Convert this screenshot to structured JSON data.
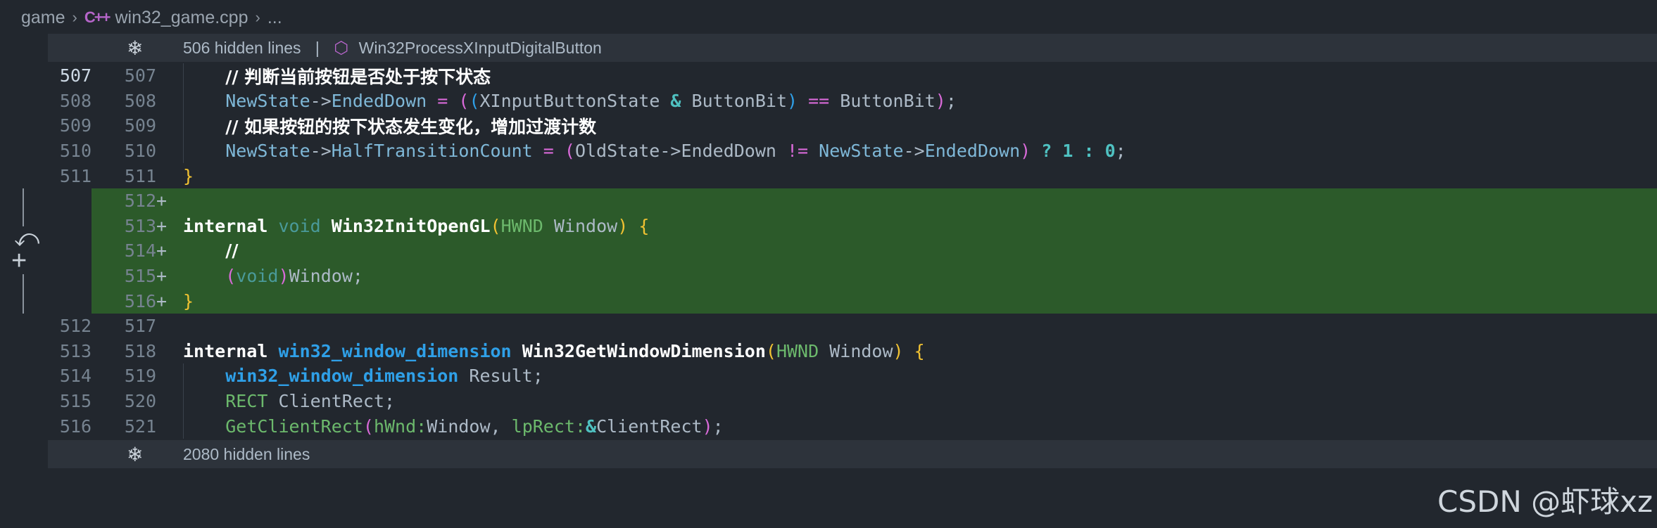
{
  "breadcrumb": {
    "root": "game",
    "file_icon": "cpp-icon",
    "file": "win32_game.cpp",
    "more": "..."
  },
  "fold_top": {
    "hidden": "506 hidden lines",
    "divider": "|",
    "symbol": "Win32ProcessXInputDigitalButton"
  },
  "fold_bottom": {
    "hidden": "2080 hidden lines"
  },
  "lines": [
    {
      "old": "507",
      "new": "507",
      "mark": ""
    },
    {
      "old": "508",
      "new": "508",
      "mark": ""
    },
    {
      "old": "509",
      "new": "509",
      "mark": ""
    },
    {
      "old": "510",
      "new": "510",
      "mark": ""
    },
    {
      "old": "511",
      "new": "511",
      "mark": ""
    },
    {
      "old": "",
      "new": "512",
      "mark": "+"
    },
    {
      "old": "",
      "new": "513",
      "mark": "+"
    },
    {
      "old": "",
      "new": "514",
      "mark": "+"
    },
    {
      "old": "",
      "new": "515",
      "mark": "+"
    },
    {
      "old": "",
      "new": "516",
      "mark": "+"
    },
    {
      "old": "512",
      "new": "517",
      "mark": ""
    },
    {
      "old": "513",
      "new": "518",
      "mark": ""
    },
    {
      "old": "514",
      "new": "519",
      "mark": ""
    },
    {
      "old": "515",
      "new": "520",
      "mark": ""
    },
    {
      "old": "516",
      "new": "521",
      "mark": ""
    }
  ],
  "code": {
    "l507": {
      "comment": "// 判断当前按钮是否处于按下状态"
    },
    "l508": {
      "a": "NewState",
      "arrow": "->",
      "b": "EndedDown",
      "eq": " = ",
      "p1": "(",
      "p2": "(",
      "c": "XInputButtonState",
      "amp": " & ",
      "d": "ButtonBit",
      "p3": ")",
      "eqeq": " == ",
      "e": "ButtonBit",
      "p4": ")",
      "semi": ";"
    },
    "l509": {
      "comment": "// 如果按钮的按下状态发生变化，增加过渡计数"
    },
    "l510": {
      "a": "NewState",
      "arrow": "->",
      "b": "HalfTransitionCount",
      "eq": " = ",
      "p1": "(",
      "c": "OldState",
      "arrow2": "->",
      "d": "EndedDown",
      "neq": " != ",
      "e": "NewState",
      "arrow3": "->",
      "f": "EndedDown",
      "p2": ")",
      "q": " ? ",
      "one": "1",
      "colon": " : ",
      "zero": "0",
      "semi": ";"
    },
    "l511": {
      "brace": "}"
    },
    "l512": {
      "text": ""
    },
    "l513": {
      "kw": "internal",
      "void": "void",
      "fn": "Win32InitOpenGL",
      "p1": "(",
      "type": "HWND",
      "arg": "Window",
      "p2": ")",
      "brace": "{"
    },
    "l514": {
      "text": "//"
    },
    "l515": {
      "p1": "(",
      "void": "void",
      "p2": ")",
      "rest": "Window;"
    },
    "l516": {
      "brace": "}"
    },
    "l517": {
      "text": ""
    },
    "l518": {
      "kw": "internal",
      "type": "win32_window_dimension",
      "fn": "Win32GetWindowDimension",
      "p1": "(",
      "atype": "HWND",
      "arg": "Window",
      "p2": ")",
      "brace": "{"
    },
    "l519": {
      "type": "win32_window_dimension",
      "rest": "Result;"
    },
    "l520": {
      "type": "RECT",
      "rest": "ClientRect;"
    },
    "l521": {
      "fn": "GetClientRect",
      "p1": "(",
      "h1": "hWnd:",
      "a1": "Window,",
      "h2": "lpRect:",
      "amp": "&",
      "a2": "ClientRect",
      "p2": ")",
      "semi": ";"
    }
  },
  "watermark": "CSDN @虾球xz",
  "colors": {
    "background": "#22272e",
    "added_line": "#2c5a2a",
    "fold_bar": "#2d333b",
    "type_blue": "#2fa0e8",
    "paren_yellow": "#f1c232",
    "operator_pink": "#d96ad9",
    "number_teal": "#4fc1c1"
  }
}
